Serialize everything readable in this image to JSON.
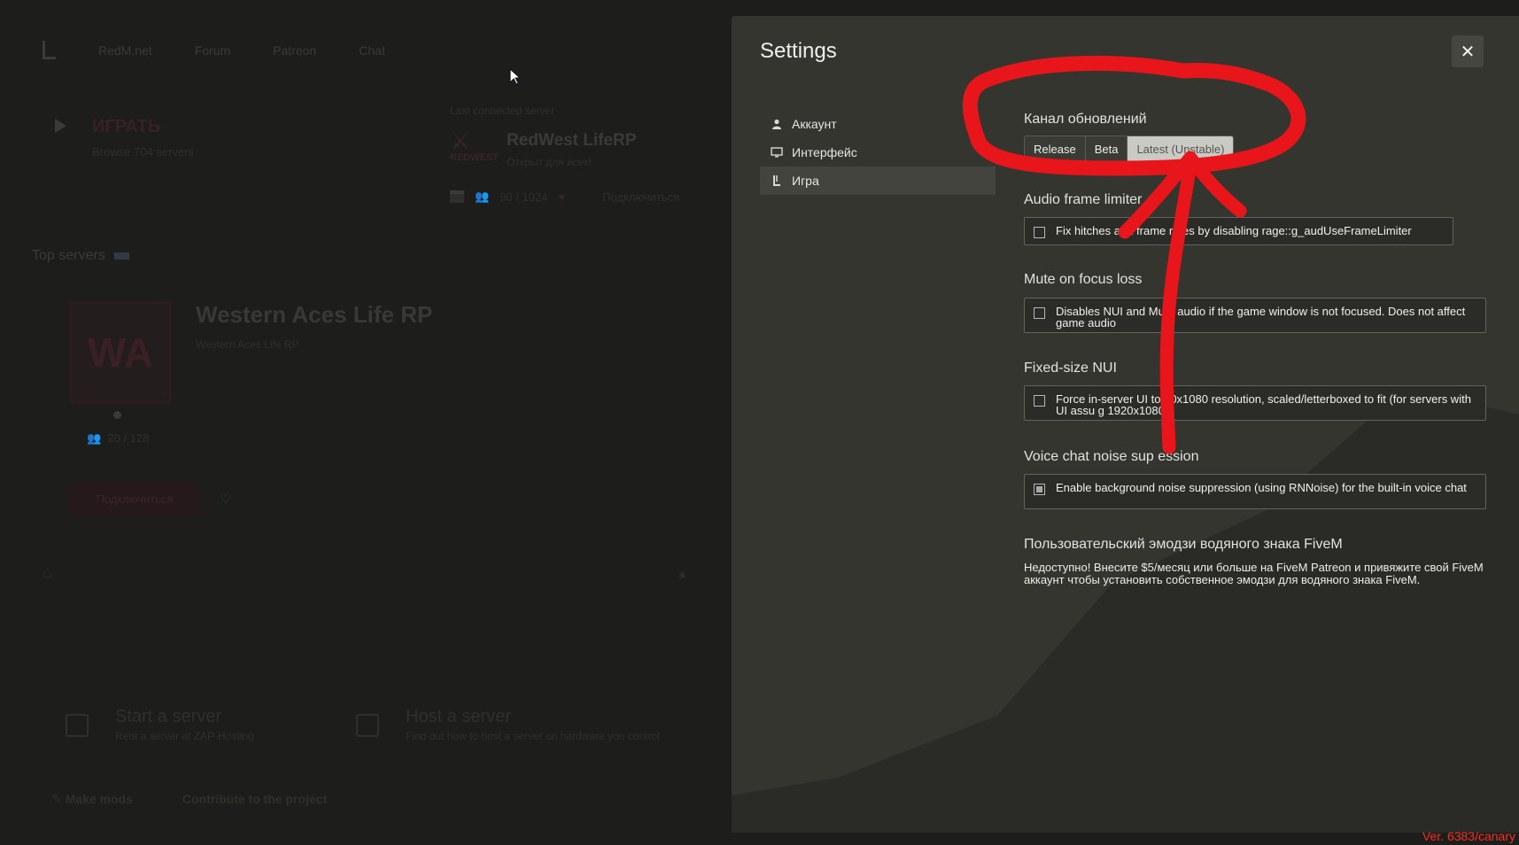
{
  "background": {
    "nav": {
      "items": [
        "RedM.net",
        "Forum",
        "Patreon",
        "Chat"
      ]
    },
    "play": {
      "title": "ИГРАТЬ",
      "subtitle": "Browse 704 servers"
    },
    "last_server": {
      "label": "Last connected server",
      "logo_text": "REDWEST",
      "name": "RedWest LifeRP",
      "status": "Открыт для всех!",
      "players": "90 / 1024",
      "connect": "Подключиться"
    },
    "top_servers": {
      "title": "Top servers"
    },
    "featured": {
      "logo_text": "WA",
      "title": "Western Aces Life RP",
      "subtitle": "Western Aces Life RP",
      "players": "20 / 128",
      "connect": "Подключиться"
    },
    "bottom_cards": [
      {
        "title": "Start a server",
        "subtitle": "Rent a server at ZAP-Hosting",
        "icon": "zap-icon"
      },
      {
        "title": "Host a server",
        "subtitle": "Find out how to host a server on hardware you control",
        "icon": "server-icon"
      }
    ],
    "footer": {
      "make_mods": "Make mods",
      "contribute": "Contribute to the project"
    }
  },
  "settings": {
    "title": "Settings",
    "nav": [
      {
        "label": "Аккаунт",
        "icon": "user-icon",
        "active": false
      },
      {
        "label": "Интерфейс",
        "icon": "monitor-icon",
        "active": false
      },
      {
        "label": "Игра",
        "icon": "game-icon",
        "active": true
      }
    ],
    "update_channel": {
      "title": "Канал обновлений",
      "options": [
        "Release",
        "Beta",
        "Latest (Unstable)"
      ],
      "selected": "Latest (Unstable)"
    },
    "audio_frame_limiter": {
      "title": "Audio frame limiter",
      "checkbox_text": "Fix hitches at h     frame rates by disabling rage::g_audUseFrameLimiter",
      "checked": false
    },
    "mute_on_focus_loss": {
      "title": "Mute on focus loss",
      "checkbox_text": "Disables NUI and Mum    audio if the game window is not focused. Does not affect game audio",
      "checked": false
    },
    "fixed_size_nui": {
      "title": "Fixed-size NUI",
      "checkbox_text": "Force in-server UI to    20x1080 resolution, scaled/letterboxed to fit (for servers with UI assu    g 1920x1080)",
      "checked": false
    },
    "voice_noise_suppression": {
      "title": "Voice chat noise sup    ession",
      "checkbox_text": "Enable background noise suppression (using RNNoise) for the built-in voice chat",
      "checked": true
    },
    "custom_emoji": {
      "title": "Пользовательский эмодзи водяного знака FiveM",
      "text": "Недоступно! Внесите $5/месяц или больше на FiveM Patreon и привяжите свой FiveM аккаунт чтобы установить собственное эмодзи для водяного знака FiveM."
    }
  },
  "version": "Ver. 6383/canary",
  "colors": {
    "annotation": "#e8151b",
    "modal_bg": "#2d2e29",
    "segment_active": "#c9cac4",
    "version_text": "#ff2a1a"
  }
}
